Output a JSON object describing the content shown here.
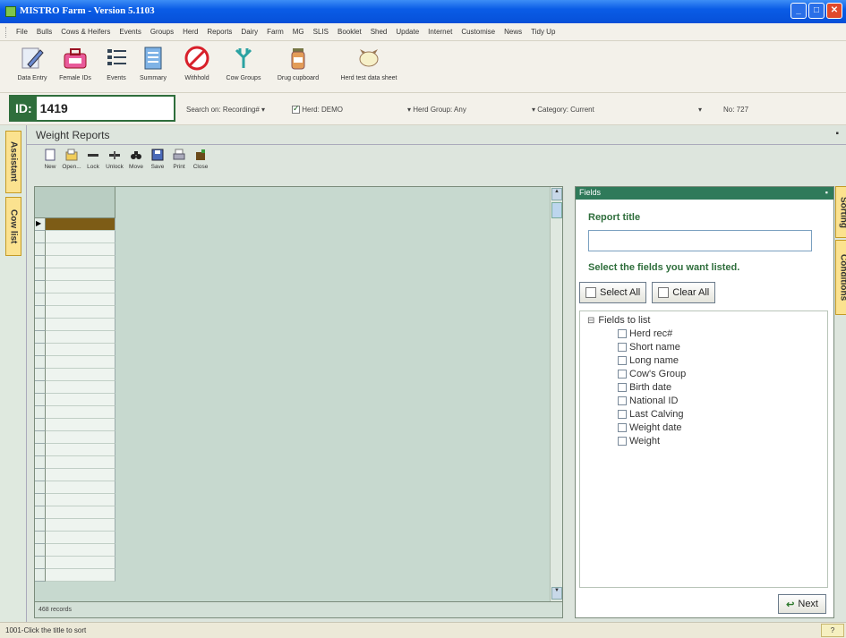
{
  "window": {
    "title": "MISTRO Farm - Version 5.1103"
  },
  "menu": [
    "File",
    "Bulls",
    "Cows & Heifers",
    "Events",
    "Groups",
    "Herd",
    "Reports",
    "Dairy",
    "Farm",
    "MG",
    "SLIS",
    "Booklet",
    "Shed",
    "Update",
    "Internet",
    "Customise",
    "News",
    "Tidy Up"
  ],
  "toolbar": [
    {
      "label": "Data Entry",
      "icon": "pencil-icon"
    },
    {
      "label": "Female IDs",
      "icon": "female-ids-icon"
    },
    {
      "label": "Events",
      "icon": "events-icon"
    },
    {
      "label": "Summary",
      "icon": "summary-icon"
    },
    {
      "label": "Withhold",
      "icon": "withhold-icon"
    },
    {
      "label": "Cow Groups",
      "icon": "cow-groups-icon"
    },
    {
      "label": "Drug cupboard",
      "icon": "drug-cupboard-icon"
    },
    {
      "label": "Herd test data sheet",
      "icon": "herd-test-icon"
    }
  ],
  "idbar": {
    "id_label": "ID:",
    "id_value": "1419",
    "search_on": "Search on: Recording#",
    "herd": "Herd: DEMO",
    "herd_group": "Herd Group: Any",
    "category": "Category: Current",
    "no": "No: 727"
  },
  "left_tabs": [
    "Assistant",
    "Cow list"
  ],
  "weight_reports": {
    "title": "Weight Reports",
    "buttons": [
      "New",
      "Open...",
      "Lock",
      "Unlock",
      "Move",
      "Save",
      "Print",
      "Close"
    ],
    "records": "468 records"
  },
  "fields_panel": {
    "header": "Fields",
    "report_title_label": "Report title",
    "report_title_value": "",
    "select_label": "Select the fields you want listed.",
    "select_all": "Select All",
    "clear_all": "Clear All",
    "tree_root": "Fields to list",
    "items": [
      "Herd rec#",
      "Short name",
      "Long name",
      "Cow's Group",
      "Birth date",
      "National ID",
      "Last Calving",
      "Weight date",
      "Weight"
    ],
    "next": "Next"
  },
  "right_tabs": [
    "Sorting",
    "Conditions"
  ],
  "status": {
    "text": "1001-Click the title to sort"
  }
}
